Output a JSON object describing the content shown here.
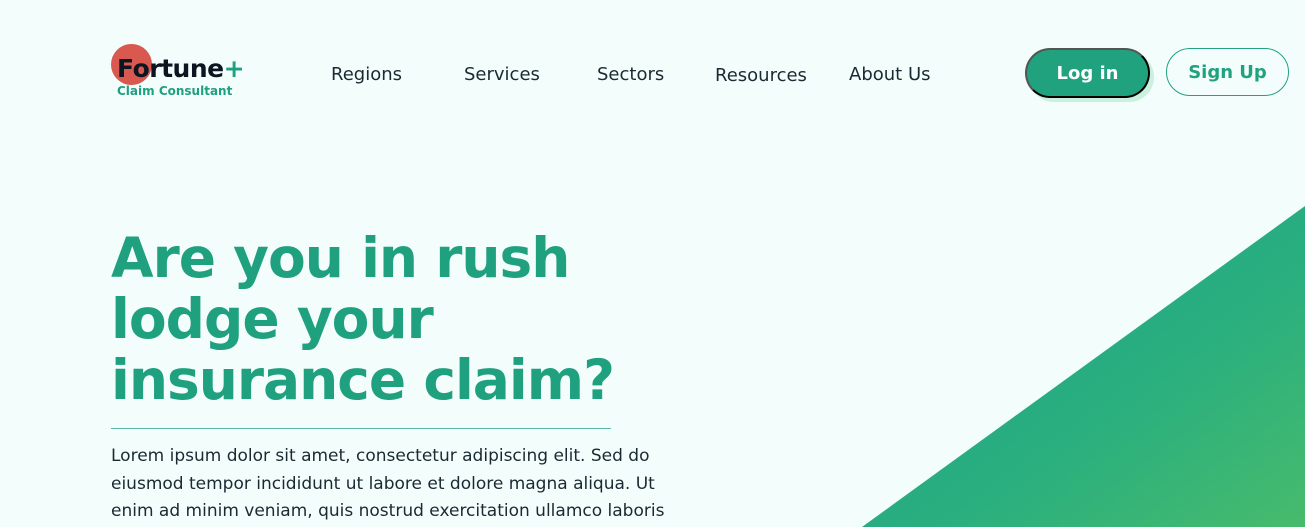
{
  "header": {
    "logo": {
      "wordmark_dark": "Fortune",
      "wordmark_plus": "+",
      "subtitle": "Claim Consultant"
    },
    "nav": [
      {
        "label": "Regions"
      },
      {
        "label": "Services"
      },
      {
        "label": "Sectors"
      },
      {
        "label": "Resources"
      },
      {
        "label": "About Us"
      }
    ],
    "login_label": "Log in",
    "signup_label": "Sign Up"
  },
  "hero": {
    "title_lines": [
      "Are you in rush",
      "lodge your",
      "insurance claim?"
    ],
    "body_lines": [
      "Lorem ipsum dolor sit amet, consectetur adipiscing elit. Sed do",
      "eiusmod tempor incididunt ut labore et dolore magna aliqua. Ut",
      "enim ad minim veniam, quis nostrud exercitation ullamco laboris"
    ]
  },
  "colors": {
    "background": "#f3fdfb",
    "primary_green": "#21a27f",
    "logo_circle": "#d9584f",
    "button_shadow": "#c9f1dd",
    "text_dark": "#1a2a33"
  }
}
